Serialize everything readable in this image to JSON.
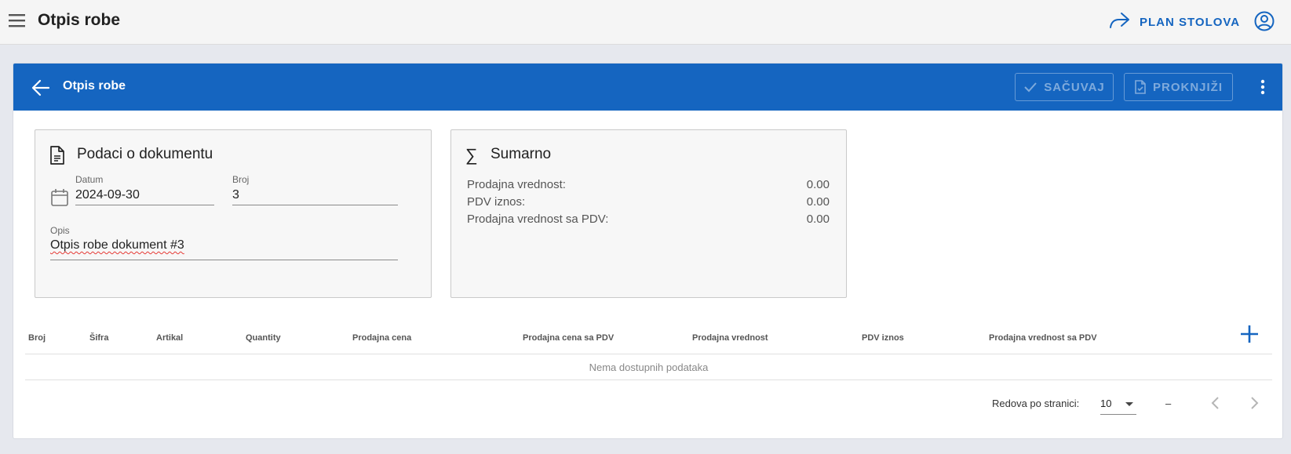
{
  "appbar": {
    "title": "Otpis robe",
    "plan_label": "PLAN STOLOVA",
    "menu_icon": "menu-icon",
    "account_icon": "account-circle-icon",
    "accent": "#1565c0"
  },
  "card": {
    "title": "Otpis robe",
    "save_label": "SAČUVAJ",
    "book_label": "PROKNJIŽI",
    "header_color": "#1565c0"
  },
  "document": {
    "title": "Podaci o dokumentu",
    "date_label": "Datum",
    "date_value": "2024-09-30",
    "number_label": "Broj",
    "number_value": "3",
    "description_label": "Opis",
    "description_value": "Otpis robe dokument #3"
  },
  "summary": {
    "title": "Sumarno",
    "rows": [
      {
        "label": "Prodajna vrednost:",
        "value": "0.00"
      },
      {
        "label": "PDV iznos:",
        "value": "0.00"
      },
      {
        "label": "Prodajna vrednost sa PDV:",
        "value": "0.00"
      }
    ]
  },
  "table": {
    "columns": [
      "Broj",
      "Šifra",
      "Artikal",
      "Quantity",
      "Prodajna cena",
      "Prodajna cena sa PDV",
      "Prodajna vrednost",
      "PDV iznos",
      "Prodajna vrednost sa PDV"
    ],
    "empty_text": "Nema dostupnih podataka",
    "rows_per_page_label": "Redova po stranici:",
    "rows_per_page": "10",
    "range_text": "–"
  }
}
